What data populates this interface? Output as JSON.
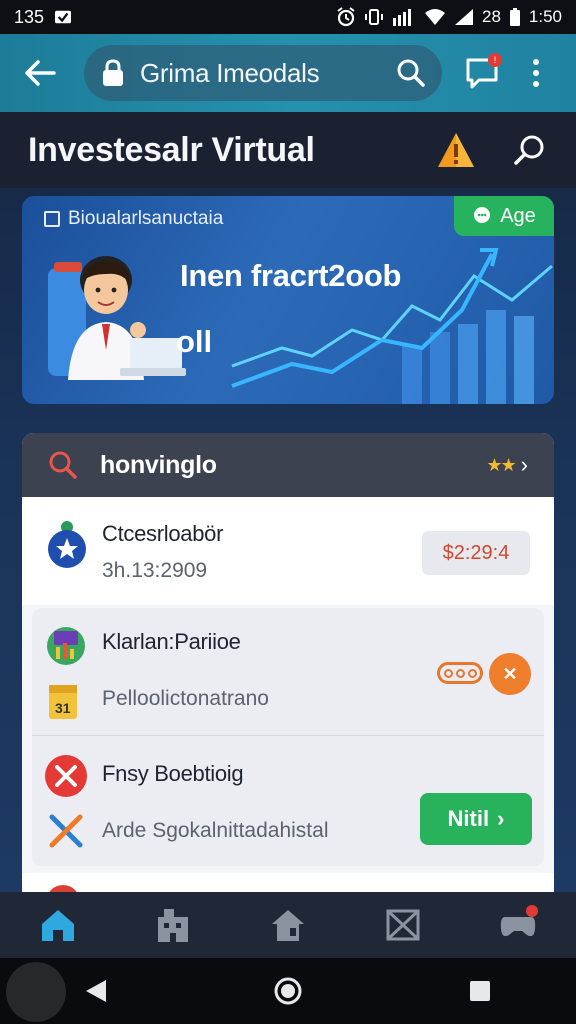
{
  "status_bar": {
    "left_text": "135",
    "signal_text": "28",
    "time": "1:50"
  },
  "app_bar": {
    "search_title": "Grima Imeodals",
    "chat_badge": "!"
  },
  "header": {
    "title": "Investesalr Virtual"
  },
  "banner": {
    "label": "Bioualarlsanuctaia",
    "badge": "Age",
    "headline": "Inen fracrt2oob",
    "subline": "oll"
  },
  "card": {
    "header_label": "honvinglo",
    "stars": "★★",
    "rows": [
      {
        "title": "Ctcesrloabör",
        "subtitle": "3h.13:2909",
        "price": "$2:29:4"
      },
      {
        "title": "Klarlan:Pariioe",
        "subtitle": "Pelloolictonatrano"
      },
      {
        "title": "Fnsy Boebtioig",
        "subtitle": "Arde Sgokalnittadahistal",
        "button": "Nitil"
      }
    ]
  },
  "colors": {
    "app_bar": "#2591ad",
    "accent_green": "#29b25c",
    "accent_orange": "#ee7d2c",
    "nav_active": "#2fa8e0"
  }
}
